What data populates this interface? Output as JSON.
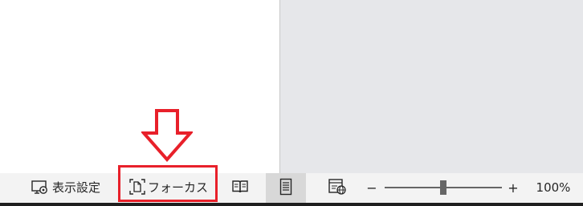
{
  "statusbar": {
    "display_settings_label": "表示設定",
    "focus_label": "フォーカス",
    "zoom_level": "100%",
    "zoom_fraction": 0.5
  },
  "colors": {
    "annotation": "#e8202a",
    "statusbar_bg": "#f3f3f3",
    "workspace_bg": "#e6e7ea",
    "active_view_bg": "#d8d8d8"
  },
  "icons": {
    "display_settings": "display-settings-icon",
    "focus": "focus-icon",
    "read_mode": "book-icon",
    "print_layout": "page-icon",
    "web_layout": "web-layout-icon",
    "annotation": "down-arrow-icon"
  }
}
